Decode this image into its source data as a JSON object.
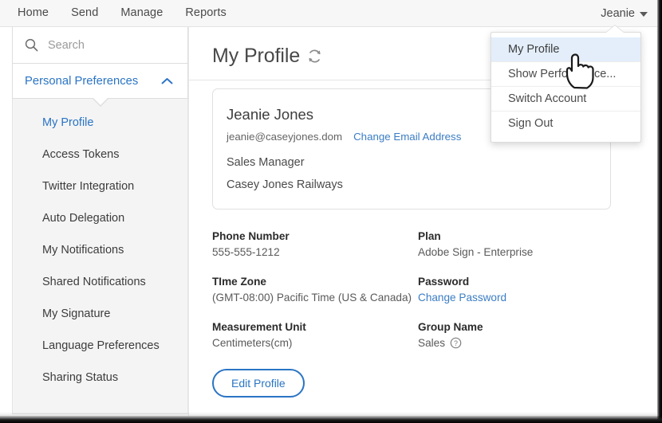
{
  "topnav": {
    "items": [
      {
        "label": "Home"
      },
      {
        "label": "Send"
      },
      {
        "label": "Manage"
      },
      {
        "label": "Reports"
      }
    ],
    "user": {
      "label": "Jeanie",
      "caret_icon": "caret-down-icon"
    }
  },
  "user_menu": {
    "items": [
      {
        "label": "My Profile",
        "active": true
      },
      {
        "label": "Show Performance...",
        "active": false
      },
      {
        "label": "Switch Account",
        "active": false
      },
      {
        "label": "Sign Out",
        "active": false
      }
    ]
  },
  "sidebar": {
    "search": {
      "placeholder": "Search",
      "value": "",
      "icon": "search-icon"
    },
    "section": {
      "label": "Personal Preferences",
      "collapse_icon": "chevron-up-icon",
      "expanded": true
    },
    "items": [
      {
        "label": "My Profile",
        "selected": true
      },
      {
        "label": "Access Tokens",
        "selected": false
      },
      {
        "label": "Twitter Integration",
        "selected": false
      },
      {
        "label": "Auto Delegation",
        "selected": false
      },
      {
        "label": "My Notifications",
        "selected": false
      },
      {
        "label": "Shared Notifications",
        "selected": false
      },
      {
        "label": "My Signature",
        "selected": false
      },
      {
        "label": "Language Preferences",
        "selected": false
      },
      {
        "label": "Sharing Status",
        "selected": false
      }
    ]
  },
  "main": {
    "page_title": "My Profile",
    "refresh_icon": "refresh-icon",
    "profile_card": {
      "name": "Jeanie Jones",
      "email": "jeanie@caseyjones.dom",
      "change_email_link": "Change Email Address",
      "role": "Sales Manager",
      "company": "Casey Jones Railways"
    },
    "details": [
      {
        "label": "Phone Number",
        "value": "555-555-1212",
        "is_link": false
      },
      {
        "label": "Plan",
        "value": "Adobe Sign - Enterprise",
        "is_link": false
      },
      {
        "label": "TIme Zone",
        "value": "(GMT-08:00) Pacific Time (US & Canada)",
        "is_link": false
      },
      {
        "label": "Password",
        "value": "Change Password",
        "is_link": true
      },
      {
        "label": "Measurement Unit",
        "value": "Centimeters(cm)",
        "is_link": false
      },
      {
        "label": "Group Name",
        "value": "Sales",
        "is_link": false,
        "help_icon": "help-circle-icon"
      }
    ],
    "edit_button": "Edit Profile"
  },
  "colors": {
    "accent_blue": "#2a74c4",
    "link_blue": "#3b7dc4",
    "menu_highlight": "#e3eefa",
    "sidebar_bg": "#f4f4f4",
    "topnav_bg": "#f7f7f7"
  },
  "cursor": {
    "type": "pointing-hand-cursor"
  }
}
